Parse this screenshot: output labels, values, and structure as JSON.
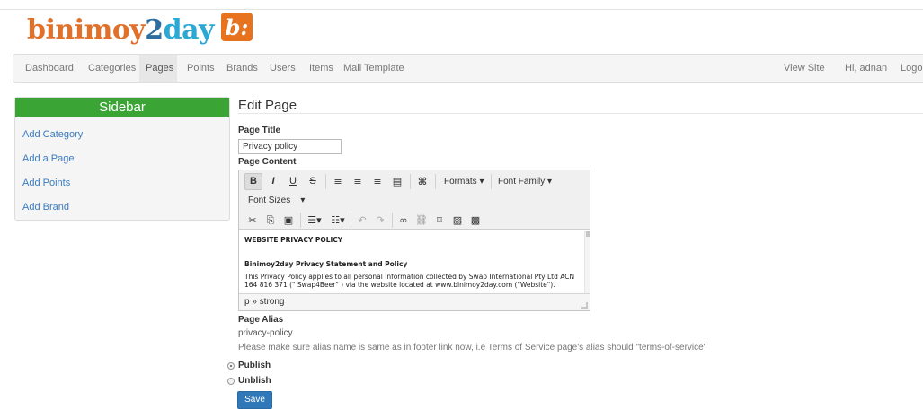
{
  "brand": {
    "name_part1": "binimoy",
    "name_part2": "2",
    "name_part3": "day",
    "badge_glyph": "b:"
  },
  "colors": {
    "brand_orange": "#e0712b",
    "brand_blue": "#2d6ea0",
    "brand_cyan": "#2ba9d4",
    "sidebar_green": "#3aa534",
    "link_blue": "#3b7bbf",
    "save_blue": "#3178b8"
  },
  "nav": {
    "left": [
      "Dashboard",
      "Categories",
      "Pages",
      "Points",
      "Brands",
      "Users",
      "Items",
      "Mail Template"
    ],
    "active": "Pages",
    "right": [
      "View Site",
      "Hi, adnan",
      "Logout"
    ]
  },
  "sidebar": {
    "title": "Sidebar",
    "links": [
      "Add Category",
      "Add a Page",
      "Add Points",
      "Add Brand"
    ]
  },
  "form": {
    "heading": "Edit Page",
    "page_title_label": "Page Title",
    "page_title_value": "Privacy policy",
    "page_content_label": "Page Content",
    "page_alias_label": "Page Alias",
    "page_alias_value": "privacy-policy",
    "alias_hint": "Please make sure alias name is same as in footer link now, i.e Terms of Service page's alias should \"terms-of-service\"",
    "publish_label": "Publish",
    "unpublish_label": "Unblish",
    "publish_selected": "Publish",
    "save_label": "Save"
  },
  "editor": {
    "toolbar_row1": {
      "bold": "B",
      "italic": "I",
      "underline": "U",
      "strike": "S",
      "formats": "Formats",
      "font_family": "Font Family"
    },
    "toolbar_row2": {
      "font_sizes": "Font Sizes"
    },
    "content": {
      "heading1": "WEBSITE PRIVACY POLICY",
      "heading2": "Binimoy2day Privacy Statement and Policy",
      "paragraph": "This Privacy Policy applies to all personal information collected by Swap International Pty Ltd ACN 164 816 371 (\" Swap4Beer\" ) via the website located at www.binimoy2day.com (\"Website\")."
    },
    "status_path": "p » strong"
  },
  "icons": {
    "cut": "scissors-icon",
    "copy": "copy-icon",
    "paste": "paste-icon",
    "bullet_list": "bullet-list-icon",
    "numbered_list": "numbered-list-icon",
    "undo": "undo-icon",
    "redo": "redo-icon",
    "link": "link-icon",
    "unlink": "unlink-icon",
    "bookmark": "bookmark-icon",
    "image": "image-icon",
    "media": "media-icon",
    "find": "binoculars-icon"
  }
}
